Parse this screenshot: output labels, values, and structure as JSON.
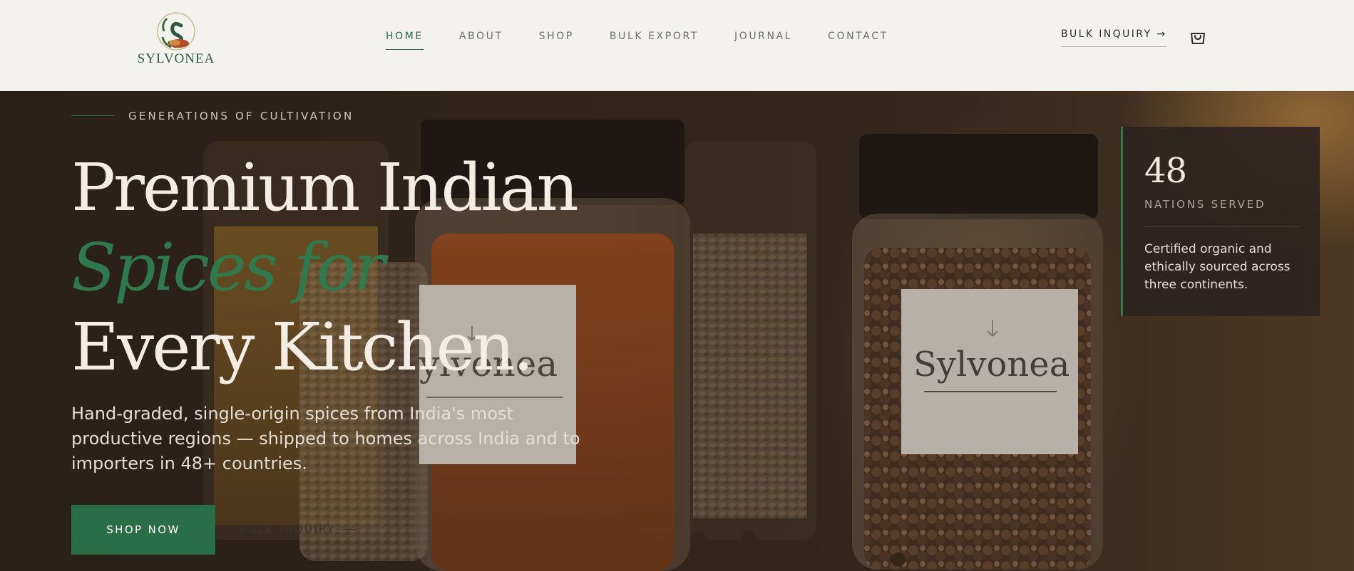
{
  "brand": {
    "name": "SYLVONEA"
  },
  "nav": {
    "items": [
      {
        "label": "HOME",
        "active": true
      },
      {
        "label": "ABOUT"
      },
      {
        "label": "SHOP"
      },
      {
        "label": "BULK EXPORT"
      },
      {
        "label": "JOURNAL"
      },
      {
        "label": "CONTACT"
      }
    ],
    "bulk_inquiry": "BULK INQUIRY →",
    "cart_icon": "shopping-bag-icon"
  },
  "hero": {
    "eyebrow": "GENERATIONS OF CULTIVATION",
    "headline_1": "Premium Indian",
    "headline_2": "Spices for",
    "headline_3": "Every Kitchen.",
    "lede": "Hand-graded, single-origin spices from India's most productive regions — shipped to homes across India and to importers in 48+ countries.",
    "cta_primary": "SHOP NOW",
    "cta_secondary": "BULK INQUIRY",
    "jar_label_left": "ylvonea",
    "jar_label_right": "Sylvonea"
  },
  "stat": {
    "number": "48",
    "label": "NATIONS SERVED",
    "text": "Certified organic and ethically sourced across three continents."
  },
  "colors": {
    "accent_green": "#2a6e47",
    "header_bg": "#f3f2ee",
    "hero_dark": "#2c231d"
  }
}
